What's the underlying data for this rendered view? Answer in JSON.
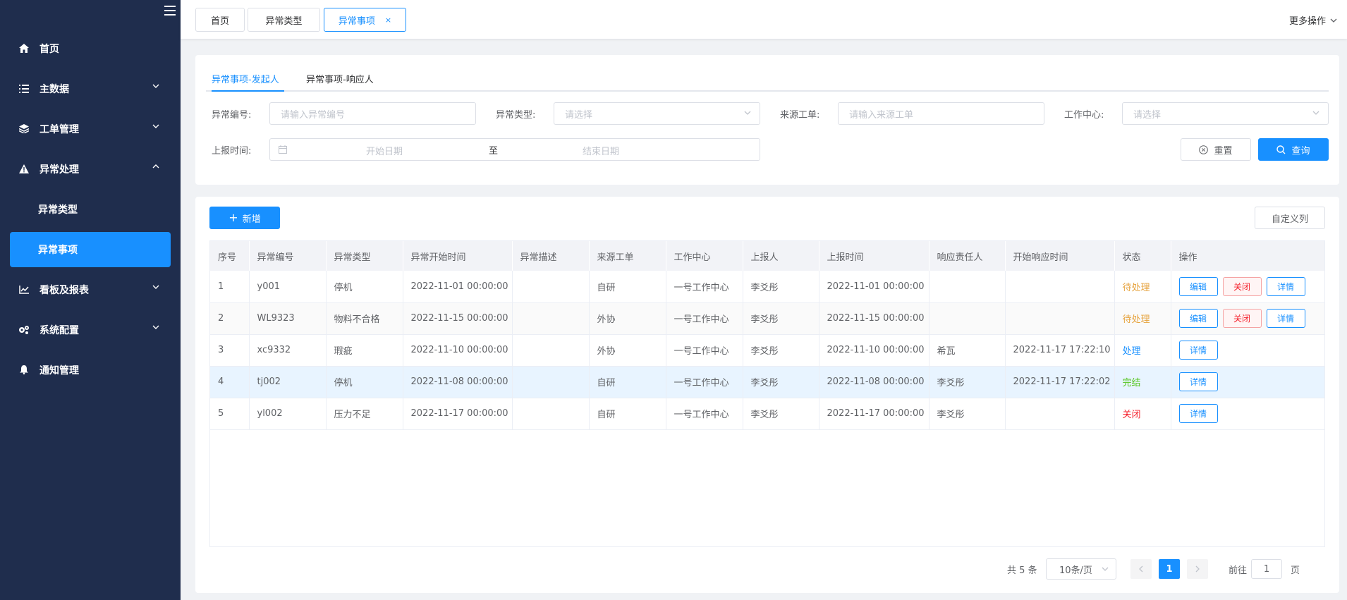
{
  "sidebar": {
    "items": [
      {
        "label": "首页",
        "icon": "home-icon"
      },
      {
        "label": "主数据",
        "icon": "list-icon"
      },
      {
        "label": "工单管理",
        "icon": "layers-icon"
      },
      {
        "label": "异常处理",
        "icon": "warning-icon"
      },
      {
        "label": "看板及报表",
        "icon": "chart-icon"
      },
      {
        "label": "系统配置",
        "icon": "gears-icon"
      },
      {
        "label": "通知管理",
        "icon": "bell-icon"
      }
    ],
    "sub_items": [
      {
        "label": "异常类型"
      },
      {
        "label": "异常事项"
      }
    ],
    "colors": {
      "bg": "#1f2d4d",
      "active": "#1890ff"
    }
  },
  "tabs": [
    {
      "label": "首页"
    },
    {
      "label": "异常类型"
    },
    {
      "label": "异常事项",
      "close": "×"
    }
  ],
  "more_ops": "更多操作",
  "subtabs": [
    {
      "label": "异常事项-发起人"
    },
    {
      "label": "异常事项-响应人"
    }
  ],
  "filters": {
    "code_label": "异常编号:",
    "code_placeholder": "请输入异常编号",
    "type_label": "异常类型:",
    "type_placeholder": "请选择",
    "source_label": "来源工单:",
    "source_placeholder": "请输入来源工单",
    "center_label": "工作中心:",
    "center_placeholder": "请选择",
    "time_label": "上报时间:",
    "start_placeholder": "开始日期",
    "sep": "至",
    "end_placeholder": "结束日期",
    "reset": "重置",
    "query": "查询"
  },
  "toolbar": {
    "add": "新增",
    "custom_columns": "自定义列"
  },
  "table": {
    "headers": [
      "序号",
      "异常编号",
      "异常类型",
      "异常开始时间",
      "异常描述",
      "来源工单",
      "工作中心",
      "上报人",
      "上报时间",
      "响应责任人",
      "开始响应时间",
      "状态",
      "操作"
    ],
    "rows": [
      {
        "no": "1",
        "code": "y001",
        "type": "停机",
        "start": "2022-11-01 00:00:00",
        "desc": "",
        "source": "自研",
        "center": "一号工作中心",
        "reporter": "李爻彤",
        "report_time": "2022-11-01 00:00:00",
        "responder": "",
        "resp_time": "",
        "status": "待处理"
      },
      {
        "no": "2",
        "code": "WL9323",
        "type": "物料不合格",
        "start": "2022-11-15 00:00:00",
        "desc": "",
        "source": "外协",
        "center": "一号工作中心",
        "reporter": "李爻彤",
        "report_time": "2022-11-15 00:00:00",
        "responder": "",
        "resp_time": "",
        "status": "待处理"
      },
      {
        "no": "3",
        "code": "xc9332",
        "type": "瑕疵",
        "start": "2022-11-10 00:00:00",
        "desc": "",
        "source": "外协",
        "center": "一号工作中心",
        "reporter": "李爻彤",
        "report_time": "2022-11-10 00:00:00",
        "responder": "希瓦",
        "resp_time": "2022-11-17 17:22:10",
        "status": "处理"
      },
      {
        "no": "4",
        "code": "tj002",
        "type": "停机",
        "start": "2022-11-08 00:00:00",
        "desc": "",
        "source": "自研",
        "center": "一号工作中心",
        "reporter": "李爻彤",
        "report_time": "2022-11-08 00:00:00",
        "responder": "李爻彤",
        "resp_time": "2022-11-17 17:22:02",
        "status": "完结"
      },
      {
        "no": "5",
        "code": "yl002",
        "type": "压力不足",
        "start": "2022-11-17 00:00:00",
        "desc": "",
        "source": "自研",
        "center": "一号工作中心",
        "reporter": "李爻彤",
        "report_time": "2022-11-17 00:00:00",
        "responder": "李爻彤",
        "resp_time": "",
        "status": "关闭"
      }
    ],
    "actions": {
      "edit": "编辑",
      "close": "关闭",
      "detail": "详情"
    }
  },
  "pager": {
    "total": "共 5 条",
    "size": "10条/页",
    "page": "1",
    "goto_prefix": "前往",
    "goto_value": "1",
    "goto_suffix": "页"
  }
}
